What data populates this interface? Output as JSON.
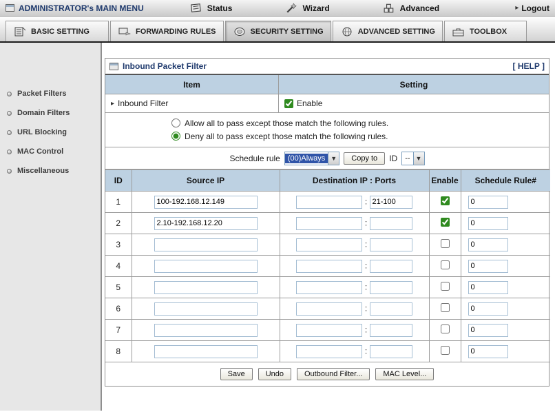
{
  "colors": {
    "header_blue": "#bdd1e2",
    "title_navy": "#1f3a6d",
    "check_green": "#2f8a1f"
  },
  "topbar": {
    "title": "ADMINISTRATOR's MAIN MENU",
    "items": [
      {
        "label": "Status"
      },
      {
        "label": "Wizard"
      },
      {
        "label": "Advanced"
      }
    ],
    "logout": "Logout"
  },
  "tabs": [
    {
      "label": "BASIC SETTING",
      "active": false
    },
    {
      "label": "FORWARDING RULES",
      "active": false
    },
    {
      "label": "SECURITY SETTING",
      "active": true
    },
    {
      "label": "ADVANCED SETTING",
      "active": false
    },
    {
      "label": "TOOLBOX",
      "active": false
    }
  ],
  "sidebar": {
    "items": [
      {
        "label": "Packet Filters"
      },
      {
        "label": "Domain Filters"
      },
      {
        "label": "URL Blocking"
      },
      {
        "label": "MAC Control"
      },
      {
        "label": "Miscellaneous"
      }
    ]
  },
  "main": {
    "title": "Inbound Packet Filter",
    "help_label": "[ HELP ]",
    "columns": {
      "item": "Item",
      "setting": "Setting"
    },
    "inbound_filter": {
      "label": "Inbound Filter",
      "enable_label": "Enable",
      "enabled": true
    },
    "policy": {
      "allow": {
        "label": "Allow all to pass except those match the following rules.",
        "selected": false
      },
      "deny": {
        "label": "Deny all to pass except those match the following rules.",
        "selected": true
      }
    },
    "schedule": {
      "label": "Schedule rule",
      "selected": "(00)Always",
      "copy_label": "Copy to",
      "id_label": "ID",
      "id_selected": "--"
    },
    "table": {
      "headers": {
        "id": "ID",
        "source": "Source IP",
        "dest": "Destination IP : Ports",
        "enable": "Enable",
        "schedule": "Schedule Rule#"
      },
      "rows": [
        {
          "id": "1",
          "src": "100-192.168.12.149",
          "dst_ip": "",
          "dst_port": "21-100",
          "enabled": true,
          "rule": "0"
        },
        {
          "id": "2",
          "src": "2.10-192.168.12.20",
          "dst_ip": "",
          "dst_port": "",
          "enabled": true,
          "rule": "0"
        },
        {
          "id": "3",
          "src": "",
          "dst_ip": "",
          "dst_port": "",
          "enabled": false,
          "rule": "0"
        },
        {
          "id": "4",
          "src": "",
          "dst_ip": "",
          "dst_port": "",
          "enabled": false,
          "rule": "0"
        },
        {
          "id": "5",
          "src": "",
          "dst_ip": "",
          "dst_port": "",
          "enabled": false,
          "rule": "0"
        },
        {
          "id": "6",
          "src": "",
          "dst_ip": "",
          "dst_port": "",
          "enabled": false,
          "rule": "0"
        },
        {
          "id": "7",
          "src": "",
          "dst_ip": "",
          "dst_port": "",
          "enabled": false,
          "rule": "0"
        },
        {
          "id": "8",
          "src": "",
          "dst_ip": "",
          "dst_port": "",
          "enabled": false,
          "rule": "0"
        }
      ]
    },
    "buttons": {
      "save": "Save",
      "undo": "Undo",
      "outbound": "Outbound Filter...",
      "mac": "MAC Level..."
    }
  }
}
